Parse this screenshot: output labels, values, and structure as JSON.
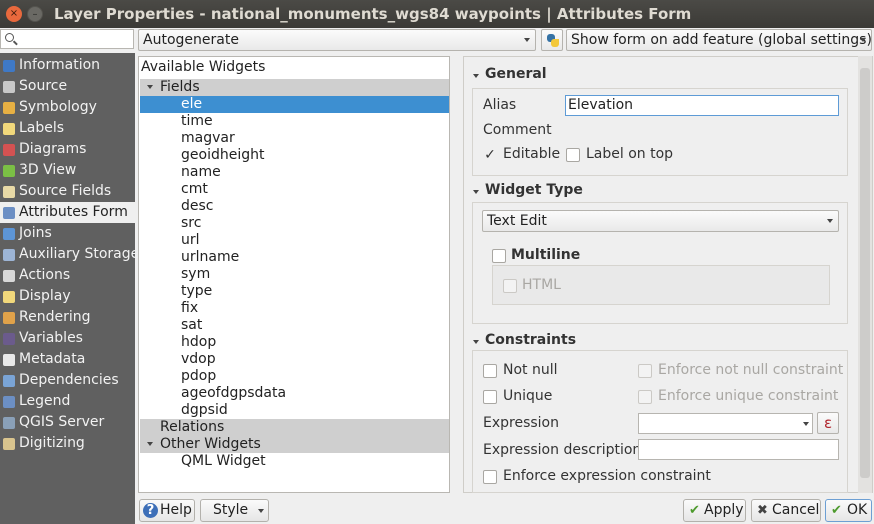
{
  "window": {
    "title": "Layer Properties - national_monuments_wgs84 waypoints | Attributes Form",
    "close_glyph": "×",
    "minimize_glyph": "–"
  },
  "search": {
    "placeholder": ""
  },
  "sidebar": {
    "items": [
      {
        "label": "Information",
        "icon": "info-icon",
        "color": "#3f79c6"
      },
      {
        "label": "Source",
        "icon": "gear-icon",
        "color": "#c8c8c8"
      },
      {
        "label": "Symbology",
        "icon": "paint-icon",
        "color": "#e7b043"
      },
      {
        "label": "Labels",
        "icon": "label-icon",
        "color": "#f1d87b"
      },
      {
        "label": "Diagrams",
        "icon": "diagram-icon",
        "color": "#d45252"
      },
      {
        "label": "3D View",
        "icon": "cube-icon",
        "color": "#7bbf45"
      },
      {
        "label": "Source Fields",
        "icon": "fields-icon",
        "color": "#e8d9a6"
      },
      {
        "label": "Attributes Form",
        "icon": "form-icon",
        "color": "#6c8fc4"
      },
      {
        "label": "Joins",
        "icon": "join-icon",
        "color": "#5d95d6"
      },
      {
        "label": "Auxiliary Storage",
        "icon": "storage-icon",
        "color": "#9db5d6"
      },
      {
        "label": "Actions",
        "icon": "actions-icon",
        "color": "#d8d8d8"
      },
      {
        "label": "Display",
        "icon": "display-icon",
        "color": "#f1d87b"
      },
      {
        "label": "Rendering",
        "icon": "brush-icon",
        "color": "#e0a24a"
      },
      {
        "label": "Variables",
        "icon": "variables-icon",
        "color": "#6b5b8c"
      },
      {
        "label": "Metadata",
        "icon": "metadata-icon",
        "color": "#e8e8e8"
      },
      {
        "label": "Dependencies",
        "icon": "dependencies-icon",
        "color": "#7aa4d6"
      },
      {
        "label": "Legend",
        "icon": "legend-icon",
        "color": "#6c8fc4"
      },
      {
        "label": "QGIS Server",
        "icon": "server-icon",
        "color": "#8aa0b8"
      },
      {
        "label": "Digitizing",
        "icon": "digitizing-icon",
        "color": "#d9c48e"
      }
    ]
  },
  "top": {
    "layout_combo": "Autogenerate",
    "suppress_combo": "Show form on add feature (global settings)"
  },
  "tree": {
    "header": "Available Widgets",
    "fields_group": "Fields",
    "fields": [
      "ele",
      "time",
      "magvar",
      "geoidheight",
      "name",
      "cmt",
      "desc",
      "src",
      "url",
      "urlname",
      "sym",
      "type",
      "fix",
      "sat",
      "hdop",
      "vdop",
      "pdop",
      "ageofdgpsdata",
      "dgpsid"
    ],
    "selected_index": 0,
    "relations_group": "Relations",
    "other_group": "Other Widgets",
    "other": [
      "QML Widget"
    ]
  },
  "general": {
    "title": "General",
    "alias_label": "Alias",
    "alias_value": "Elevation",
    "comment_label": "Comment",
    "editable_label": "Editable",
    "editable_checked": true,
    "editable_mark": "✓",
    "label_on_top_label": "Label on top"
  },
  "widget_type": {
    "title": "Widget Type",
    "value": "Text Edit",
    "multiline_label": "Multiline",
    "html_label": "HTML"
  },
  "constraints": {
    "title": "Constraints",
    "not_null_label": "Not null",
    "enforce_not_null_label": "Enforce not null constraint",
    "unique_label": "Unique",
    "enforce_unique_label": "Enforce unique constraint",
    "expression_label": "Expression",
    "expression_description_label": "Expression description",
    "enforce_expression_label": "Enforce expression constraint",
    "expression_button_glyph": "ε"
  },
  "buttons": {
    "help": "Help",
    "help_glyph": "?",
    "style": "Style",
    "apply": "Apply",
    "apply_glyph": "✔",
    "cancel": "Cancel",
    "cancel_glyph": "✖",
    "ok": "OK",
    "ok_glyph": "✔"
  }
}
